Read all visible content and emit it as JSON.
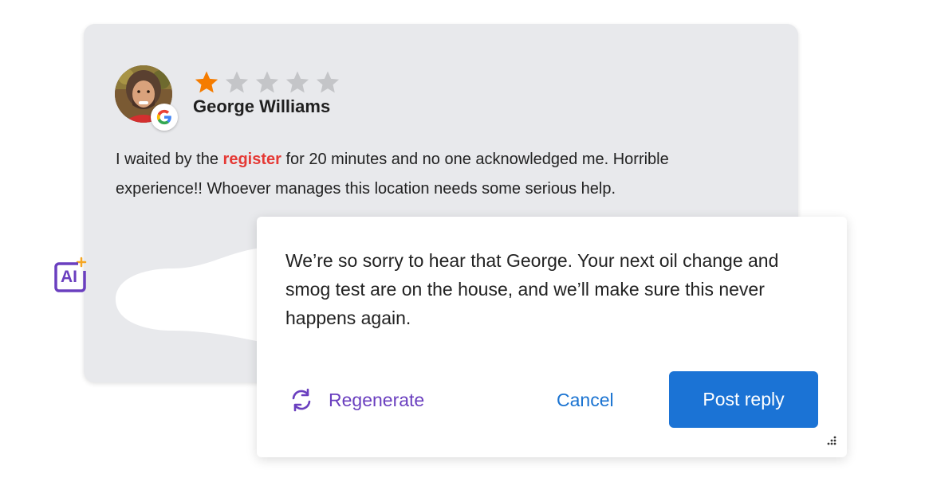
{
  "review": {
    "rating": 1,
    "max_rating": 5,
    "reviewer_name": "George Williams",
    "source_icon": "google-icon",
    "text_before": "I waited by the ",
    "text_highlight": "register",
    "text_after": " for 20 minutes and no one acknowledged me. Horrible experience!! Whoever manages this location needs some serious help."
  },
  "ai": {
    "label": "AI",
    "icon": "ai-sparkle-icon"
  },
  "reply": {
    "text": "We’re so sorry to hear that George. Your next oil change and smog test are on the house, and we’ll make sure this never happens again.",
    "regenerate_label": "Regenerate",
    "cancel_label": "Cancel",
    "post_label": "Post reply"
  },
  "colors": {
    "star_filled": "#f57c00",
    "star_empty": "#c4c5c8",
    "highlight": "#e53935",
    "primary": "#1b73d5",
    "ai_purple": "#6a3fbf",
    "card_bg": "#e8e9ec"
  }
}
